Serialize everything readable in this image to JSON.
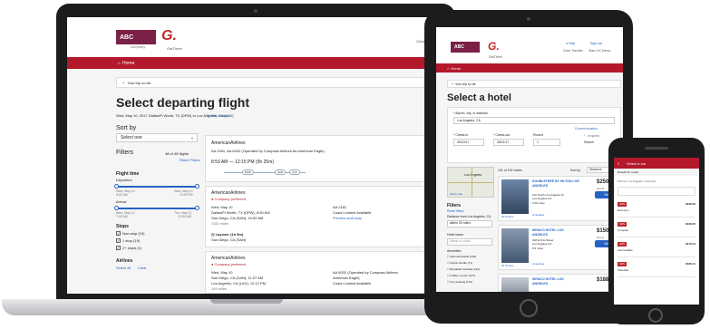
{
  "laptop": {
    "brand": {
      "abc_logo": "ABC",
      "abc_sub": "company",
      "gettthere_logo": "G.",
      "gettthere_name": "GetThere"
    },
    "header": {
      "help_link": "Help",
      "user_name": "Chris Traveler"
    },
    "nav": {
      "home": "Home"
    },
    "trip_bar": "Your trip so far",
    "page_title": "Select departing flight",
    "date_line": "Wed, May 10, 2017 Dallas/Ft Worth, TX (DFW) to Los Angeles, CA (LAX)",
    "edit_search": "Edit search",
    "sort": {
      "label": "Sort by",
      "value": "Select one"
    },
    "filters": {
      "label": "Filters",
      "count": "48 of 48 flights",
      "reset": "Reset Filters"
    },
    "flight_time": {
      "label": "Flight time",
      "departure": "Departure",
      "dep_min": "Wed, May 10\n6:00 AM",
      "dep_max": "Wed, May 10\n11:59 PM",
      "arrival": "Arrival",
      "arr_min": "Wed, May 10\n7:00 AM",
      "arr_max": "Thu, May 11\n12:59 AM"
    },
    "stops": {
      "label": "Stops",
      "options": [
        "Non-stop (24)",
        "1 stop (19)",
        "2+ stops (1)"
      ]
    },
    "airlines": {
      "label": "Airlines",
      "select_all": "Select all",
      "clear": "Clear"
    },
    "company_pref_tab": "Compan",
    "cards": [
      {
        "airline": "AmericanAirlines",
        "flight_line": "AA 2181, AA 6032 (Operated by Compass Airlines As American Eagle)",
        "time": "8:50 AM — 12:15 PM (5h 25m)",
        "right_text": "Lowe",
        "route_codes": [
          "DFW",
          "SAN",
          "LAX"
        ]
      },
      {
        "airline": "AmericanAirlines",
        "preferred": "Company preferred",
        "date": "Wed, May 10",
        "depart": "Dallas/Ft Worth, TX (DFW), 8:50 AM",
        "arrive": "San Diego, CA (SAN), 10:00 AM",
        "miles": "1180 miles",
        "flight_no": "AA 2181",
        "fare": "Coach Lowest Available",
        "preview": "Preview seat map",
        "layover": "Layover (1h 5m)",
        "layover_city": "San Diego, CA (SAN)"
      },
      {
        "airline": "AmericanAirlines",
        "preferred": "Company preferred",
        "date": "Wed, May 10",
        "depart": "San Diego, CA (SAN), 11:07 AM",
        "arrive": "Los Angeles, CA (LAX), 12:12 PM",
        "miles": "109 miles",
        "flight_no": "AA 6032 (Operated by Compass Airlines",
        "flight_no2": "American Eagle)",
        "fare": "Coach Lowest Available"
      }
    ]
  },
  "tablet": {
    "brand": {
      "abc_logo": "ABC",
      "gettthere_logo": "G.",
      "gettthere_name": "GetThere"
    },
    "header": {
      "help_link": "Help",
      "signout_link": "Sign out",
      "user_name": "Chris Traveler",
      "user2": "Stan U.K Demo"
    },
    "nav": {
      "home": "Home"
    },
    "trip_bar": "Your trip so far",
    "page_title": "Select a hotel",
    "form": {
      "airport_label": "* Airport, city, or address",
      "airport_value": "Los Angeles, CA",
      "current_location": "Current location",
      "checkin_label": "* Check-in",
      "checkin_value": "05/10/17",
      "checkout_label": "* Check-out",
      "checkout_value": "05/11/17",
      "rooms_label": "Rooms",
      "rooms_value": "1",
      "required": "* - required",
      "search": "Search"
    },
    "map": {
      "show_map": "Show map",
      "city": "Los Angeles"
    },
    "results": {
      "count": "101 of 101 hotels",
      "sort_label": "Sort by",
      "sort_value": "Distance"
    },
    "filters": {
      "label": "Filters",
      "reset": "Reset filters",
      "distance_label": "Distance from Los Angeles, CA",
      "distance_value": "within 25 miles",
      "hotel_name_label": "Hotel name",
      "hotel_name_placeholder": "Name or chain",
      "amenities_label": "Amenities",
      "amenities": [
        "ADA accessible (203)",
        "Airport shuttle (71)",
        "Breakfast included (214)",
        "Coffee in room (197)",
        "Dry cleaning (131)"
      ]
    },
    "hotels": [
      {
        "name": "DOUBLETREE BY HILTON LOS ANGELES",
        "addr": "120 South Los Angeles St\nLos Angeles CA",
        "dist": "0.20 miles",
        "price": "$250",
        "status": "Out of",
        "view": "View",
        "amenities": "Amenities",
        "photos": "20 Photos"
      },
      {
        "name": "MIYAKO HOTEL LOS ANGELES",
        "addr": "328 E First Street\nLos Angeles CA",
        "dist": "0.3 miles",
        "price": "$150",
        "status": "Out of",
        "view": "View",
        "amenities": "Amenities",
        "photos": "22 Photos"
      },
      {
        "name": "MIYAKO HOTEL LOS ANGELES",
        "addr": "",
        "dist": "",
        "price": "$188",
        "status": "",
        "view": "",
        "amenities": "",
        "photos": ""
      }
    ]
  },
  "phone": {
    "title": "Select a car",
    "results_text": "Results for rental",
    "summary": "Pick up: Los Angeles, CA (LAX)",
    "cars": [
      {
        "agency": "AVIS",
        "type": "Economy",
        "price": "$168.05"
      },
      {
        "agency": "AVIS",
        "type": "Compact",
        "price": "$168.05"
      },
      {
        "agency": "AVIS",
        "type": "Intermediate",
        "price": "$176.21"
      },
      {
        "agency": "AVIS",
        "type": "Standard",
        "price": "$186.21"
      }
    ],
    "colors": {
      "accent": "#b3182b",
      "brand": "#7b2046",
      "link": "#2463c4"
    }
  }
}
